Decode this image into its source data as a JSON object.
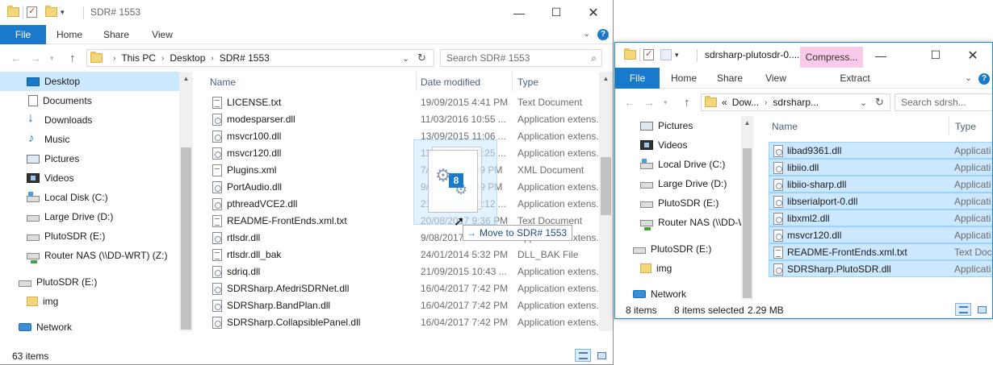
{
  "left_window": {
    "title": "SDR# 1553",
    "ribbon": {
      "file": "File",
      "home": "Home",
      "share": "Share",
      "view": "View",
      "help": "?"
    },
    "address": {
      "crumbs": [
        "This PC",
        "Desktop",
        "SDR# 1553"
      ]
    },
    "search": {
      "placeholder": "Search SDR# 1553"
    },
    "nav": [
      {
        "label": "Desktop",
        "icon": "desktop-icon",
        "selected": true
      },
      {
        "label": "Documents",
        "icon": "documents-icon"
      },
      {
        "label": "Downloads",
        "icon": "downloads-icon"
      },
      {
        "label": "Music",
        "icon": "music-icon"
      },
      {
        "label": "Pictures",
        "icon": "pictures-icon"
      },
      {
        "label": "Videos",
        "icon": "videos-icon"
      },
      {
        "label": "Local Disk (C:)",
        "icon": "local-disk-icon"
      },
      {
        "label": "Large Drive (D:)",
        "icon": "drive-icon"
      },
      {
        "label": "PlutoSDR (E:)",
        "icon": "drive-icon"
      },
      {
        "label": "Router NAS (\\\\DD-WRT) (Z:)",
        "icon": "network-drive-icon"
      },
      {
        "label": "PlutoSDR (E:)",
        "icon": "drive-icon"
      },
      {
        "label": "img",
        "icon": "folder-icon"
      },
      {
        "label": "Network",
        "icon": "network-icon"
      }
    ],
    "columns": {
      "name": "Name",
      "date": "Date modified",
      "type": "Type"
    },
    "files": [
      {
        "name": "LICENSE.txt",
        "date": "19/09/2015 4:41 PM",
        "type": "Text Document",
        "kind": "txt"
      },
      {
        "name": "modesparser.dll",
        "date": "11/03/2016 10:55 ...",
        "type": "Application extens...",
        "kind": "dll"
      },
      {
        "name": "msvcr100.dll",
        "date": "13/09/2015 11:06 ...",
        "type": "Application extens...",
        "kind": "dll"
      },
      {
        "name": "msvcr120.dll",
        "date": "11/02/2016 12:25 ...",
        "type": "Application extens...",
        "kind": "dll"
      },
      {
        "name": "Plugins.xml",
        "date": "7/05/2016 5:39 PM",
        "type": "XML Document",
        "kind": "xml"
      },
      {
        "name": "PortAudio.dll",
        "date": "9/05/2016 5:39 PM",
        "type": "Application extens...",
        "kind": "dll"
      },
      {
        "name": "pthreadVCE2.dll",
        "date": "21/09/2015 11:12 ...",
        "type": "Application extens...",
        "kind": "dll"
      },
      {
        "name": "README-FrontEnds.xml.txt",
        "date": "20/08/2017 9:36 PM",
        "type": "Text Document",
        "kind": "txt"
      },
      {
        "name": "rtlsdr.dll",
        "date": "9/08/2017 ...",
        "type": "Application extens...",
        "kind": "dll"
      },
      {
        "name": "rtlsdr.dll_bak",
        "date": "24/01/2014 5:32 PM",
        "type": "DLL_BAK File",
        "kind": "txt"
      },
      {
        "name": "sdriq.dll",
        "date": "21/09/2015 10:43 ...",
        "type": "Application extens...",
        "kind": "dll"
      },
      {
        "name": "SDRSharp.AfedriSDRNet.dll",
        "date": "16/04/2017 7:42 PM",
        "type": "Application extens...",
        "kind": "dll"
      },
      {
        "name": "SDRSharp.BandPlan.dll",
        "date": "16/04/2017 7:42 PM",
        "type": "Application extens...",
        "kind": "dll"
      },
      {
        "name": "SDRSharp.CollapsiblePanel.dll",
        "date": "16/04/2017 7:42 PM",
        "type": "Application extens...",
        "kind": "dll"
      }
    ],
    "status": {
      "items": "63 items"
    }
  },
  "drag": {
    "count": "8",
    "tooltip": "Move to SDR# 1553"
  },
  "right_window": {
    "title": "sdrsharp-plutosdr-0....",
    "compress_tab": "Compress...",
    "ribbon": {
      "file": "File",
      "home": "Home",
      "share": "Share",
      "view": "View",
      "extract": "Extract",
      "help": "?"
    },
    "address": {
      "prefix": "«",
      "crumbs": [
        "Dow...",
        "sdrsharp..."
      ]
    },
    "search": {
      "placeholder": "Search sdrsh..."
    },
    "nav": [
      {
        "label": "Pictures",
        "icon": "pictures-icon"
      },
      {
        "label": "Videos",
        "icon": "videos-icon"
      },
      {
        "label": "Local Drive (C:)",
        "icon": "local-disk-icon"
      },
      {
        "label": "Large Drive (D:)",
        "icon": "drive-icon"
      },
      {
        "label": "PlutoSDR (E:)",
        "icon": "drive-icon"
      },
      {
        "label": "Router NAS (\\\\DD-W",
        "icon": "network-drive-icon"
      },
      {
        "label": "PlutoSDR (E:)",
        "icon": "drive-icon"
      },
      {
        "label": "img",
        "icon": "folder-icon"
      },
      {
        "label": "Network",
        "icon": "network-icon"
      }
    ],
    "columns": {
      "name": "Name",
      "type": "Type"
    },
    "files": [
      {
        "name": "libad9361.dll",
        "type": "Applicati",
        "kind": "dll"
      },
      {
        "name": "libiio.dll",
        "type": "Applicati",
        "kind": "dll"
      },
      {
        "name": "libiio-sharp.dll",
        "type": "Applicati",
        "kind": "dll"
      },
      {
        "name": "libserialport-0.dll",
        "type": "Applicati",
        "kind": "dll"
      },
      {
        "name": "libxml2.dll",
        "type": "Applicati",
        "kind": "dll"
      },
      {
        "name": "msvcr120.dll",
        "type": "Applicati",
        "kind": "dll"
      },
      {
        "name": "README-FrontEnds.xml.txt",
        "type": "Text Docu",
        "kind": "txt"
      },
      {
        "name": "SDRSharp.PlutoSDR.dll",
        "type": "Applicati",
        "kind": "dll"
      }
    ],
    "status": {
      "items": "8 items",
      "selected": "8 items selected",
      "size": "2.29 MB"
    }
  },
  "colors": {
    "accent": "#1979ca",
    "selection": "#cce8ff",
    "compress_tab": "#f9cbe8"
  }
}
